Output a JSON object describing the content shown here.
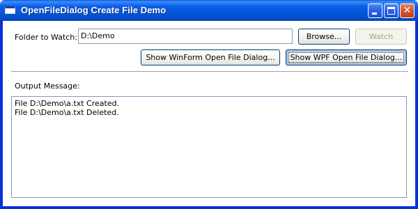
{
  "window": {
    "title": "OpenFileDialog Create File Demo"
  },
  "title_buttons": {
    "minimize": "minimize-icon",
    "maximize": "maximize-icon",
    "close": "close-icon",
    "close_glyph": "✕"
  },
  "folder": {
    "label": "Folder to Watch:",
    "value": "D:\\Demo"
  },
  "buttons": {
    "browse": "Browse...",
    "watch": "Watch",
    "winform": "Show WinForm Open File Dialog...",
    "wpf": "Show WPF Open File Dialog..."
  },
  "output": {
    "label": "Output Message:",
    "lines": [
      "File D:\\Demo\\a.txt Created.",
      "File D:\\Demo\\a.txt Deleted."
    ]
  }
}
